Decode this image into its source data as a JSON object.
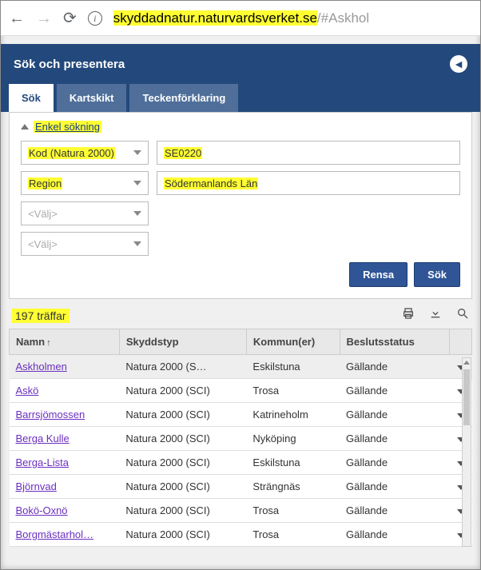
{
  "browser": {
    "url_host": "skyddadnatur.naturvardsverket.se",
    "url_path": "/#Askhol"
  },
  "panel": {
    "title": "Sök och presentera"
  },
  "tabs": {
    "sok": "Sök",
    "kartskikt": "Kartskikt",
    "teckenforklaring": "Teckenförklaring"
  },
  "search": {
    "section_label": "Enkel sökning",
    "field1_label": "Kod (Natura 2000)",
    "field1_value": "SE0220",
    "field2_label": "Region",
    "field2_value": "Södermanlands Län",
    "placeholder": "<Välj>",
    "btn_clear": "Rensa",
    "btn_search": "Sök"
  },
  "results": {
    "hit_count": "197 träffar",
    "columns": {
      "name": "Namn",
      "type": "Skyddstyp",
      "kommun": "Kommun(er)",
      "status": "Beslutsstatus"
    },
    "rows": [
      {
        "name": "Askholmen",
        "type": "Natura 2000 (S…",
        "kommun": "Eskilstuna",
        "status": "Gällande",
        "sel": true
      },
      {
        "name": "Askö",
        "type": "Natura 2000 (SCI)",
        "kommun": "Trosa",
        "status": "Gällande"
      },
      {
        "name": "Barrsjömossen",
        "type": "Natura 2000 (SCI)",
        "kommun": "Katrineholm",
        "status": "Gällande"
      },
      {
        "name": "Berga Kulle",
        "type": "Natura 2000 (SCI)",
        "kommun": "Nyköping",
        "status": "Gällande"
      },
      {
        "name": "Berga-Lista",
        "type": "Natura 2000 (SCI)",
        "kommun": "Eskilstuna",
        "status": "Gällande"
      },
      {
        "name": "Björnvad",
        "type": "Natura 2000 (SCI)",
        "kommun": "Strängnäs",
        "status": "Gällande"
      },
      {
        "name": "Bokö-Oxnö",
        "type": "Natura 2000 (SCI)",
        "kommun": "Trosa",
        "status": "Gällande"
      },
      {
        "name": "Borgmästarhol…",
        "type": "Natura 2000 (SCI)",
        "kommun": "Trosa",
        "status": "Gällande"
      }
    ]
  }
}
